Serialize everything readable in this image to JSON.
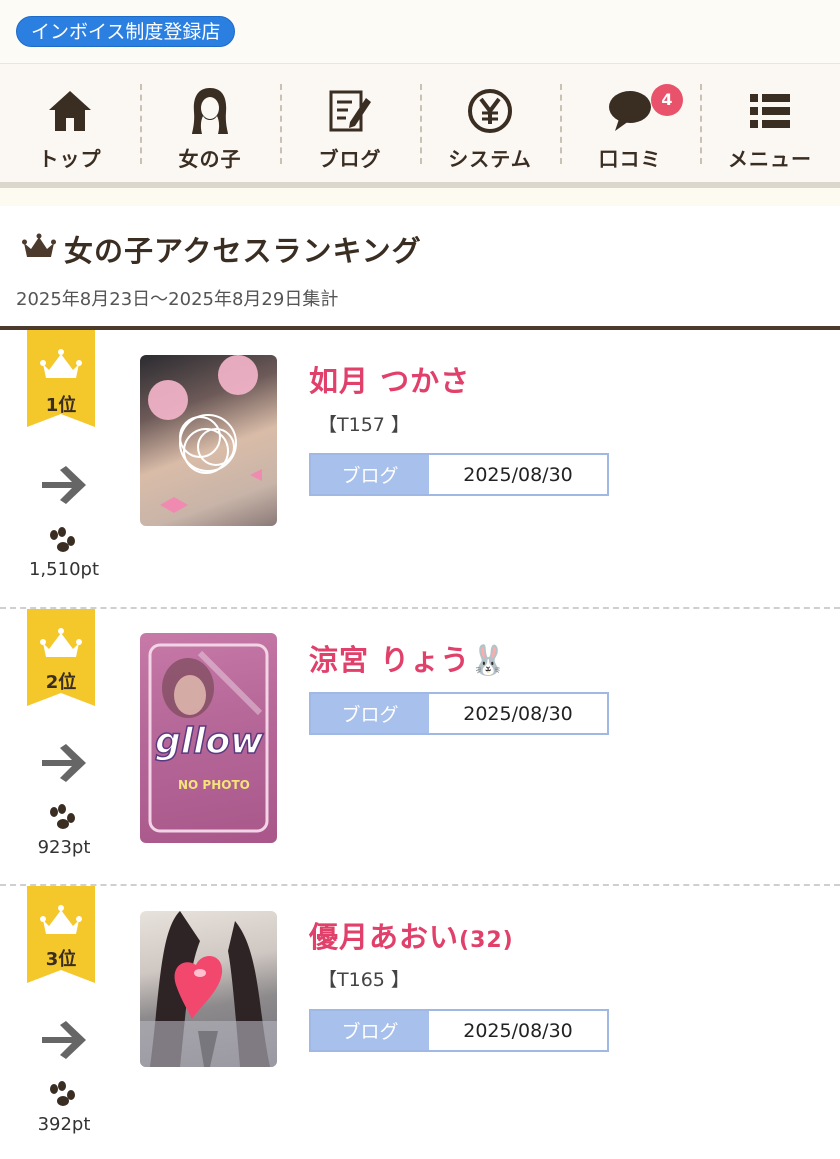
{
  "badge": {
    "invoice": "インボイス制度登録店"
  },
  "nav": {
    "items": [
      {
        "label": "トップ",
        "icon": "home-icon"
      },
      {
        "label": "女の子",
        "icon": "girl-icon"
      },
      {
        "label": "ブログ",
        "icon": "blog-icon"
      },
      {
        "label": "システム",
        "icon": "yen-icon"
      },
      {
        "label": "口コミ",
        "icon": "comment-icon",
        "badge": "4"
      },
      {
        "label": "メニュー",
        "icon": "menu-icon"
      }
    ]
  },
  "ranking": {
    "title": "女の子アクセスランキング",
    "period": "2025年8月23日～2025年8月29日集計",
    "entries": [
      {
        "rank": "1位",
        "points": "1,510pt",
        "name": "如月 つかさ",
        "size": "【T157 】",
        "blog_label": "ブログ",
        "blog_date": "2025/08/30",
        "trend": "arrow-right-icon"
      },
      {
        "rank": "2位",
        "points": "923pt",
        "name": "涼宮 りょう🐰",
        "size": "",
        "blog_label": "ブログ",
        "blog_date": "2025/08/30",
        "trend": "arrow-right-icon"
      },
      {
        "rank": "3位",
        "points": "392pt",
        "name": "優月あおい",
        "age": "(32)",
        "size": "【T165 】",
        "blog_label": "ブログ",
        "blog_date": "2025/08/30",
        "trend": "arrow-right-icon"
      }
    ]
  },
  "colors": {
    "accent": "#e0406a",
    "brand_blue": "#2a7fe0",
    "crown": "#f4c72a",
    "blog_label_bg": "#a7c0ec"
  }
}
